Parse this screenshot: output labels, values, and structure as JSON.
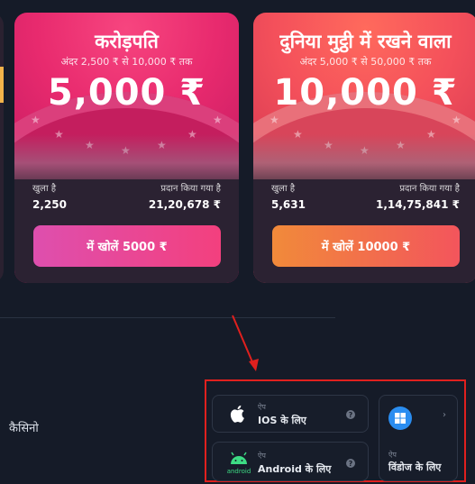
{
  "cards": [
    {
      "title": "करोड़पति",
      "subtitle": "अंदर 2,500 ₹ से 10,000 ₹ तक",
      "amount": "5,000 ₹",
      "opened_label": "खुला है",
      "opened_value": "2,250",
      "given_label": "प्रदान किया गया है",
      "given_value": "21,20,678 ₹",
      "button_label": "में खोलें 5000 ₹"
    },
    {
      "title": "दुनिया मुट्ठी में रखने वाला",
      "subtitle": "अंदर 5,000 ₹ से 50,000 ₹ तक",
      "amount": "10,000 ₹",
      "opened_label": "खुला है",
      "opened_value": "5,631",
      "given_label": "प्रदान किया गया है",
      "given_value": "1,14,75,841 ₹",
      "button_label": "में खोलें 10000 ₹"
    }
  ],
  "footer": {
    "casino_label": "कैसिनो"
  },
  "apps": {
    "ios": {
      "pre": "ऐप",
      "label": "IOS के लिए",
      "icon": "apple-icon"
    },
    "android": {
      "pre": "ऐप",
      "label": "Android के लिए",
      "icon": "android-icon",
      "icon_text": "android"
    },
    "windows": {
      "pre": "ऐप",
      "label": "विंडोज के लिए",
      "icon": "windows-icon"
    }
  },
  "colors": {
    "highlight": "#e0201e",
    "background": "#151b28"
  }
}
